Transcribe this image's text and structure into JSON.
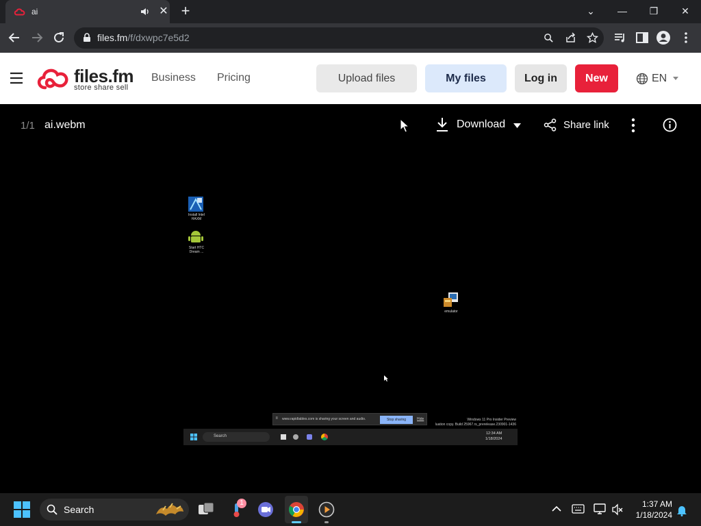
{
  "browser": {
    "tab": {
      "title": "ai",
      "close_glyph": "✕",
      "favicon": "files-fm-cloud-icon"
    },
    "new_tab_glyph": "+",
    "window_controls": {
      "dropdown": "⌄",
      "minimize": "—",
      "restore": "❐",
      "close": "✕"
    },
    "url_host": "files.fm",
    "url_path": "/f/dxwpc7e5d2"
  },
  "site": {
    "logo_text": "files.fm",
    "logo_tagline": "store  share  sell",
    "nav": {
      "business": "Business",
      "pricing": "Pricing"
    },
    "buttons": {
      "upload": "Upload files",
      "my_files": "My files",
      "login": "Log in",
      "new": "New"
    },
    "language": "EN",
    "colors": {
      "brand": "#e8213a",
      "new_button": "#e8213a",
      "my_files_bg": "#dce9fb",
      "upload_bg": "#e9e9e9",
      "login_bg": "#e6e6e6"
    }
  },
  "viewer": {
    "counter": "1/1",
    "filename": "ai.webm",
    "download_label": "Download",
    "share_label": "Share link"
  },
  "video_frame": {
    "desktop_icons": [
      {
        "label1": "Install Intel",
        "label2": "HAXM"
      },
      {
        "label1": "Start HTC",
        "label2": "Dream ..."
      },
      {
        "label1": "emulator",
        "label2": ""
      }
    ],
    "share_bar_text": "www.rapidtables.com is sharing your screen and audio.",
    "stop_sharing": "Stop sharing",
    "hide": "Hide",
    "watermark_line1": "Windows 11 Pro Insider Preview",
    "watermark_line2": "luation copy. Build 25967.rs_prerelease.230901-1436",
    "search": "Search",
    "time": "12:34 AM",
    "date": "1/18/2024"
  },
  "taskbar": {
    "search": "Search",
    "notification_count": "1",
    "time": "1:37 AM",
    "date": "1/18/2024"
  }
}
